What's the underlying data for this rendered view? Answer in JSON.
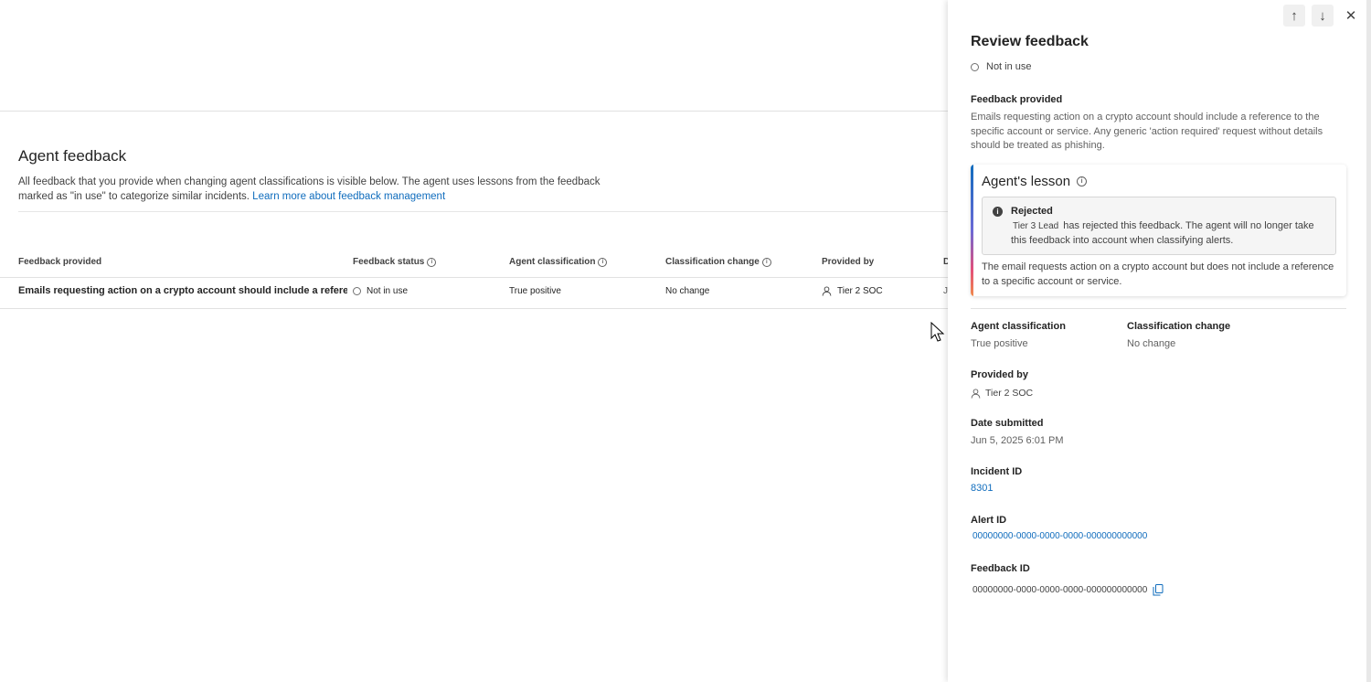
{
  "main": {
    "title": "Agent feedback",
    "description": "All feedback that you provide when changing agent classifications is visible below. The agent uses lessons from the feedback marked as \"in use\" to categorize similar incidents.",
    "learn_more": "Learn more about feedback management",
    "columns": [
      "Feedback provided",
      "Feedback status",
      "Agent classification",
      "Classification change",
      "Provided by",
      "D"
    ],
    "rows": [
      {
        "feedback": "Emails requesting action on a crypto account should include a referenc...",
        "status": "Not in use",
        "agent_classification": "True positive",
        "classification_change": "No change",
        "provided_by": "Tier 2 SOC",
        "date_partial": "Ju"
      }
    ]
  },
  "panel": {
    "title": "Review feedback",
    "status": "Not in use",
    "feedback_label": "Feedback provided",
    "feedback_text": "Emails requesting action on a crypto account should include a reference to the specific account or service. Any generic 'action required' request without details should be treated as phishing.",
    "lesson_title": "Agent's lesson",
    "rejected_title": "Rejected",
    "rejected_by": "Tier 3 Lead",
    "rejected_text": "has rejected this feedback. The agent will no longer take this feedback into account when classifying alerts.",
    "lesson_text": "The email requests action on a crypto account but does not include a reference to a specific account or service.",
    "agent_classification_label": "Agent classification",
    "agent_classification": "True positive",
    "classification_change_label": "Classification change",
    "classification_change": "No change",
    "provided_by_label": "Provided by",
    "provided_by": "Tier 2 SOC",
    "date_label": "Date submitted",
    "date": "Jun 5, 2025 6:01 PM",
    "incident_label": "Incident ID",
    "incident_id": "8301",
    "alert_label": "Alert ID",
    "alert_id": "00000000-0000-0000-0000-000000000000",
    "feedback_id_label": "Feedback ID",
    "feedback_id": "00000000-0000-0000-0000-000000000000"
  },
  "colors": {
    "link": "#0f6cbd",
    "text": "#242424",
    "muted": "#616161"
  }
}
